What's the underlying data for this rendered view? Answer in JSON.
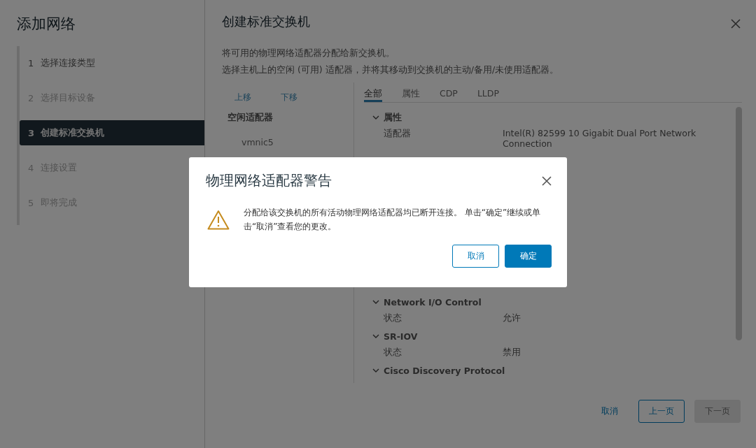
{
  "wizard": {
    "title": "添加网络",
    "steps": [
      {
        "number": "1",
        "label": "选择连接类型",
        "selected": false,
        "disabled": false
      },
      {
        "number": "2",
        "label": "选择目标设备",
        "selected": false,
        "disabled": true
      },
      {
        "number": "3",
        "label": "创建标准交换机",
        "selected": true,
        "disabled": false
      },
      {
        "number": "4",
        "label": "连接设置",
        "selected": false,
        "disabled": true
      },
      {
        "number": "5",
        "label": "即将完成",
        "selected": false,
        "disabled": true
      }
    ]
  },
  "page": {
    "title": "创建标准交换机",
    "description": [
      "将可用的物理网络适配器分配给新交换机。",
      "选择主机上的空闲 (可用) 适配器，并将其移动到交换机的主动/备用/未使用适配器。"
    ],
    "actions": [
      "上移",
      "下移"
    ],
    "adapter_groups": [
      {
        "title": "空闲适配器",
        "items": [
          {
            "label": "vmnic5"
          }
        ]
      }
    ],
    "tabs": [
      {
        "label": "全部",
        "selected": true
      },
      {
        "label": "属性",
        "selected": false
      },
      {
        "label": "CDP",
        "selected": false
      },
      {
        "label": "LLDP",
        "selected": false
      }
    ],
    "sections": [
      {
        "title": "属性",
        "expanded": true,
        "rows": [
          {
            "label": "适配器",
            "value": "Intel(R) 82599 10 Gigabit Dual Port Network Connection"
          }
        ]
      },
      {
        "title": "Network I/O Control",
        "expanded": true,
        "rows": [
          {
            "label": "状态",
            "value": "允许"
          }
        ]
      },
      {
        "title": "SR-IOV",
        "expanded": true,
        "rows": [
          {
            "label": "状态",
            "value": "禁用"
          }
        ]
      },
      {
        "title": "Cisco Discovery Protocol",
        "expanded": true
      }
    ],
    "footer_buttons": [
      {
        "label": "取消",
        "kind": "link",
        "disabled": false
      },
      {
        "label": "上一页",
        "kind": "outline",
        "disabled": false
      },
      {
        "label": "下一页",
        "kind": "solid",
        "disabled": true
      }
    ]
  },
  "dialog": {
    "title": "物理网络适配器警告",
    "message": "分配给该交换机的所有活动物理网络适配器均已断开连接。 单击“确定”继续或单击“取消”查看您的更改。",
    "buttons": [
      {
        "label": "取消",
        "kind": "outline"
      },
      {
        "label": "确定",
        "kind": "primary"
      }
    ]
  }
}
